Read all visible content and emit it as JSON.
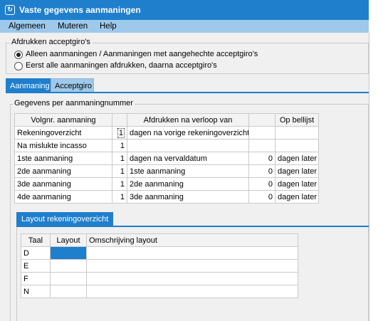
{
  "window": {
    "title": "Vaste gegevens aanmaningen",
    "icon": "app-icon"
  },
  "menu": {
    "items": [
      "Algemeen",
      "Muteren",
      "Help"
    ]
  },
  "print_group": {
    "label": "Afdrukken acceptgiro's",
    "options": [
      {
        "label": "Alleen aanmaningen / Aanmaningen met aangehechte acceptgiro's",
        "checked": true
      },
      {
        "label": "Eerst alle aanmaningen afdrukken, daarna acceptgiro's",
        "checked": false
      }
    ]
  },
  "tabs": [
    {
      "label": "Aanmaning",
      "active": true
    },
    {
      "label": "Acceptgiro",
      "active": false
    }
  ],
  "reminder_group": {
    "label": "Gegevens per aanmaningnummer",
    "headers": [
      "Volgnr. aanmaning",
      "",
      "Afdrukken na verloop van",
      "",
      "Op bellijst"
    ],
    "rows": [
      {
        "name": "Rekeningoverzicht",
        "count": "1",
        "after": "dagen na vorige rekeningoverzicht",
        "num": "",
        "list": ""
      },
      {
        "name": "Na mislukte incasso",
        "count": "1",
        "after": "",
        "num": "",
        "list": ""
      },
      {
        "name": "1ste aanmaning",
        "count": "1",
        "after": "dagen na vervaldatum",
        "num": "0",
        "list": "dagen later"
      },
      {
        "name": "2de aanmaning",
        "count": "1",
        "after": "1ste aanmaning",
        "num": "0",
        "list": "dagen later"
      },
      {
        "name": "3de aanmaning",
        "count": "1",
        "after": "2de aanmaning",
        "num": "0",
        "list": "dagen later"
      },
      {
        "name": "4de aanmaning",
        "count": "1",
        "after": "3de aanmaning",
        "num": "0",
        "list": "dagen later"
      }
    ]
  },
  "layout_tab": {
    "label": "Layout rekeningoverzicht",
    "headers": [
      "Taal",
      "Layout",
      "Omschrijving layout"
    ],
    "rows": [
      {
        "taal": "D",
        "layout": "",
        "omschrijving": ""
      },
      {
        "taal": "E",
        "layout": "",
        "omschrijving": ""
      },
      {
        "taal": "F",
        "layout": "",
        "omschrijving": ""
      },
      {
        "taal": "N",
        "layout": "",
        "omschrijving": ""
      }
    ]
  },
  "colors": {
    "accent": "#1f7fcc",
    "menu": "#9ec9ea"
  }
}
